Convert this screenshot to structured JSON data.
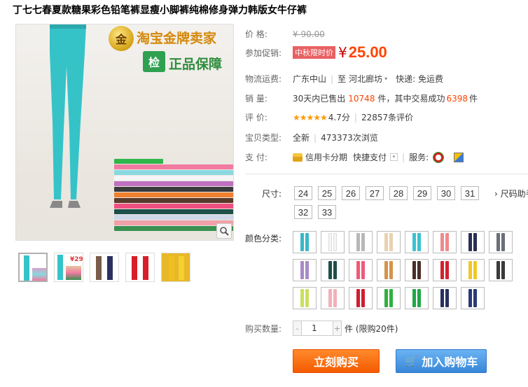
{
  "product": {
    "title": "丁七七春夏款糖果彩色铅笔裤显瘦小脚裤纯棉修身弹力韩版女牛仔裤"
  },
  "image": {
    "badge_gold_char": "金",
    "badge_gold_text": "淘宝金牌卖家",
    "badge_check_char": "检",
    "badge_check_text": "正品保障",
    "main_color": "#35c3c8"
  },
  "thumbnails": [
    {
      "colors": [
        "#35c3c8",
        "#d7a0c8"
      ]
    },
    {
      "colors": [
        "#35c3c8",
        "#e8c5a0"
      ],
      "price_text": "¥29"
    },
    {
      "colors": [
        "#7a5a48",
        "#2a3160"
      ]
    },
    {
      "colors": [
        "#d91e2a",
        "#d91e2a"
      ]
    },
    {
      "colors": [
        "#f0c020",
        "#f0c020"
      ]
    }
  ],
  "price": {
    "label": "价    格:",
    "original": "¥ 90.00"
  },
  "promo": {
    "label": "参加促销:",
    "tag": "中秋限时价",
    "currency": "¥",
    "price": "25.00"
  },
  "shipping": {
    "label": "物流运费:",
    "from": "广东中山",
    "to_prefix": "至",
    "to": "河北廊坊",
    "fee": "快递: 免运费"
  },
  "sales": {
    "label": "销    量:",
    "text1": "30天内已售出",
    "count": "10748",
    "text2": "件，其中交易成功",
    "success": "6398",
    "unit": "件"
  },
  "rating": {
    "label": "评    价:",
    "stars": "★★★★★",
    "score": "4.7分",
    "reviews": "22857条评价"
  },
  "type": {
    "label": "宝贝类型:",
    "value": "全新",
    "views": "473373次浏览"
  },
  "payment": {
    "label": "支    付:",
    "credit": "信用卡分期",
    "quick": "快捷支付",
    "service_label": "服务:"
  },
  "sizes": {
    "label": "尺寸:",
    "options": [
      "24",
      "25",
      "26",
      "27",
      "28",
      "29",
      "30",
      "31",
      "32",
      "33"
    ],
    "help": "尺码助手"
  },
  "colors": {
    "label": "颜色分类:",
    "swatches": [
      "#3ab7c7",
      "#f5f5f5",
      "#b8b8b8",
      "#e8d2b0",
      "#3ac2d0",
      "#f08a8a",
      "#2a2f55",
      "#6a6f7a",
      "#a88ac8",
      "#1e4f48",
      "#f05a7a",
      "#d6944a",
      "#4a2e28",
      "#d3202e",
      "#f0c828",
      "#3a3a3a",
      "#c8e060",
      "#f2b0b8",
      "#d01e30",
      "#30b040",
      "#20a848",
      "#283060",
      "#2a3a78"
    ]
  },
  "quantity": {
    "label": "购买数量:",
    "value": "1",
    "minus": "-",
    "plus": "+",
    "limit": "件 (限购20件)"
  },
  "actions": {
    "buy": "立刻购买",
    "cart": "加入购物车"
  }
}
